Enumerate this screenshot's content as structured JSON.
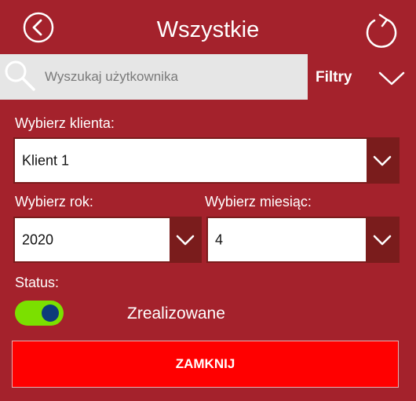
{
  "header": {
    "title": "Wszystkie",
    "back_icon": "circle-chevron-left-icon",
    "refresh_icon": "refresh-icon"
  },
  "search": {
    "placeholder": "Wyszukaj użytkownika",
    "value": "",
    "icon": "search-icon"
  },
  "filters": {
    "label": "Filtry",
    "icon": "chevron-down-icon",
    "expanded": true
  },
  "client": {
    "label": "Wybierz klienta:",
    "selected": "Klient 1"
  },
  "year": {
    "label": "Wybierz rok:",
    "selected": "2020"
  },
  "month": {
    "label": "Wybierz miesiąc:",
    "selected": "4"
  },
  "status": {
    "label": "Status:",
    "toggle_on": true,
    "value_text": "Zrealizowane"
  },
  "close_button": {
    "label": "ZAMKNIJ"
  },
  "colors": {
    "background": "#a4222c",
    "dropdown_accent": "#7a1c1c",
    "toggle_track": "#7be000",
    "toggle_knob": "#0d3b7a",
    "close_button": "#ff0000",
    "search_bar": "#e6e6e6"
  }
}
